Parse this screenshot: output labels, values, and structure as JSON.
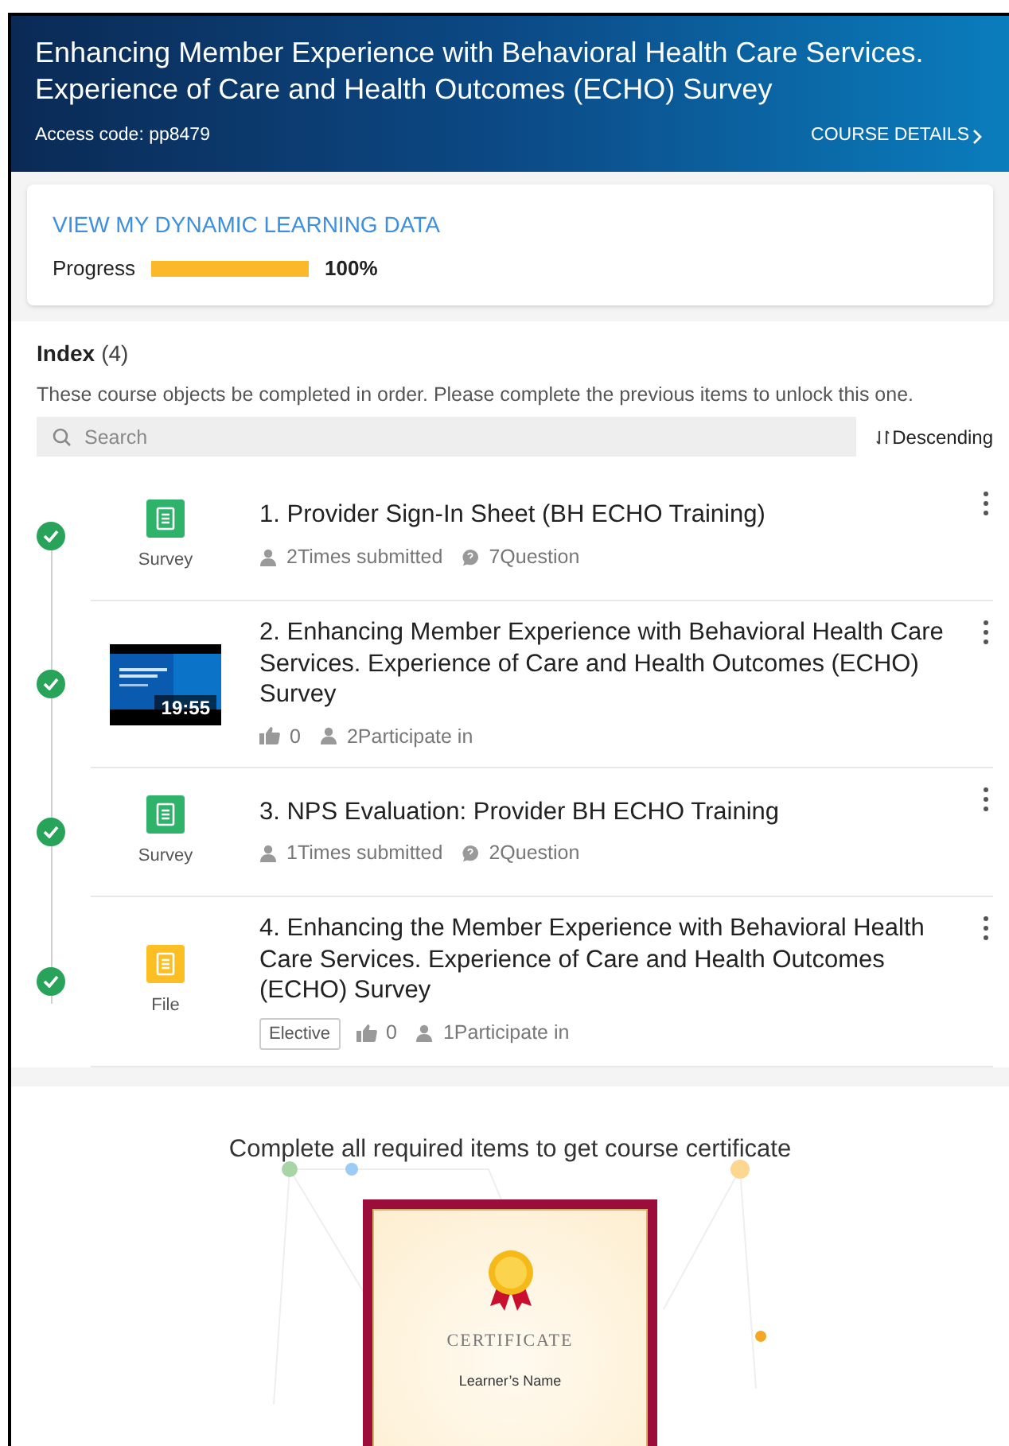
{
  "header": {
    "title": "Enhancing Member Experience with Behavioral Health Care Services. Experience  of Care and Health Outcomes (ECHO) Survey",
    "access_code": "Access code: pp8479",
    "details_link": "COURSE DETAILS"
  },
  "progress_card": {
    "link": "VIEW MY DYNAMIC LEARNING DATA",
    "label": "Progress",
    "level": 1.0,
    "percent": "100%"
  },
  "index": {
    "title": "Index",
    "count": "(4)",
    "description": "These course objects be completed in order. Please complete the previous items to unlock this one.",
    "search": {
      "placeholder": "Search"
    },
    "sort": "Descending",
    "items": [
      {
        "kind": "survey",
        "completed": true,
        "type_label": "Survey",
        "title": "1. Provider Sign-In Sheet (BH ECHO Training)",
        "stats": [
          {
            "kind": "user",
            "text": "2Times submitted"
          },
          {
            "kind": "question",
            "text": "7Question"
          }
        ]
      },
      {
        "kind": "video",
        "completed": true,
        "duration": "19:55",
        "title": "2. Enhancing Member Experience with Behavioral Health Care Services. Experience of Care and Health Outcomes (ECHO) Survey",
        "stats": [
          {
            "kind": "like",
            "text": "0"
          },
          {
            "kind": "user",
            "text": "2Participate in"
          }
        ]
      },
      {
        "kind": "survey",
        "completed": true,
        "type_label": "Survey",
        "title": "3. NPS Evaluation: Provider BH ECHO Training",
        "stats": [
          {
            "kind": "user",
            "text": "1Times submitted"
          },
          {
            "kind": "question",
            "text": "2Question"
          }
        ]
      },
      {
        "kind": "file",
        "completed": true,
        "type_label": "File",
        "title": "4. Enhancing the Member Experience with Behavioral Health Care Services. Experience of Care and Health Outcomes (ECHO) Survey",
        "tag": "Elective",
        "stats": [
          {
            "kind": "like",
            "text": "0"
          },
          {
            "kind": "user",
            "text": "1Participate in"
          }
        ]
      }
    ]
  },
  "certificate": {
    "message": "Complete all required items to get course certificate",
    "heading": "CERTIFICATE",
    "name_line": "Learner’s Name"
  }
}
